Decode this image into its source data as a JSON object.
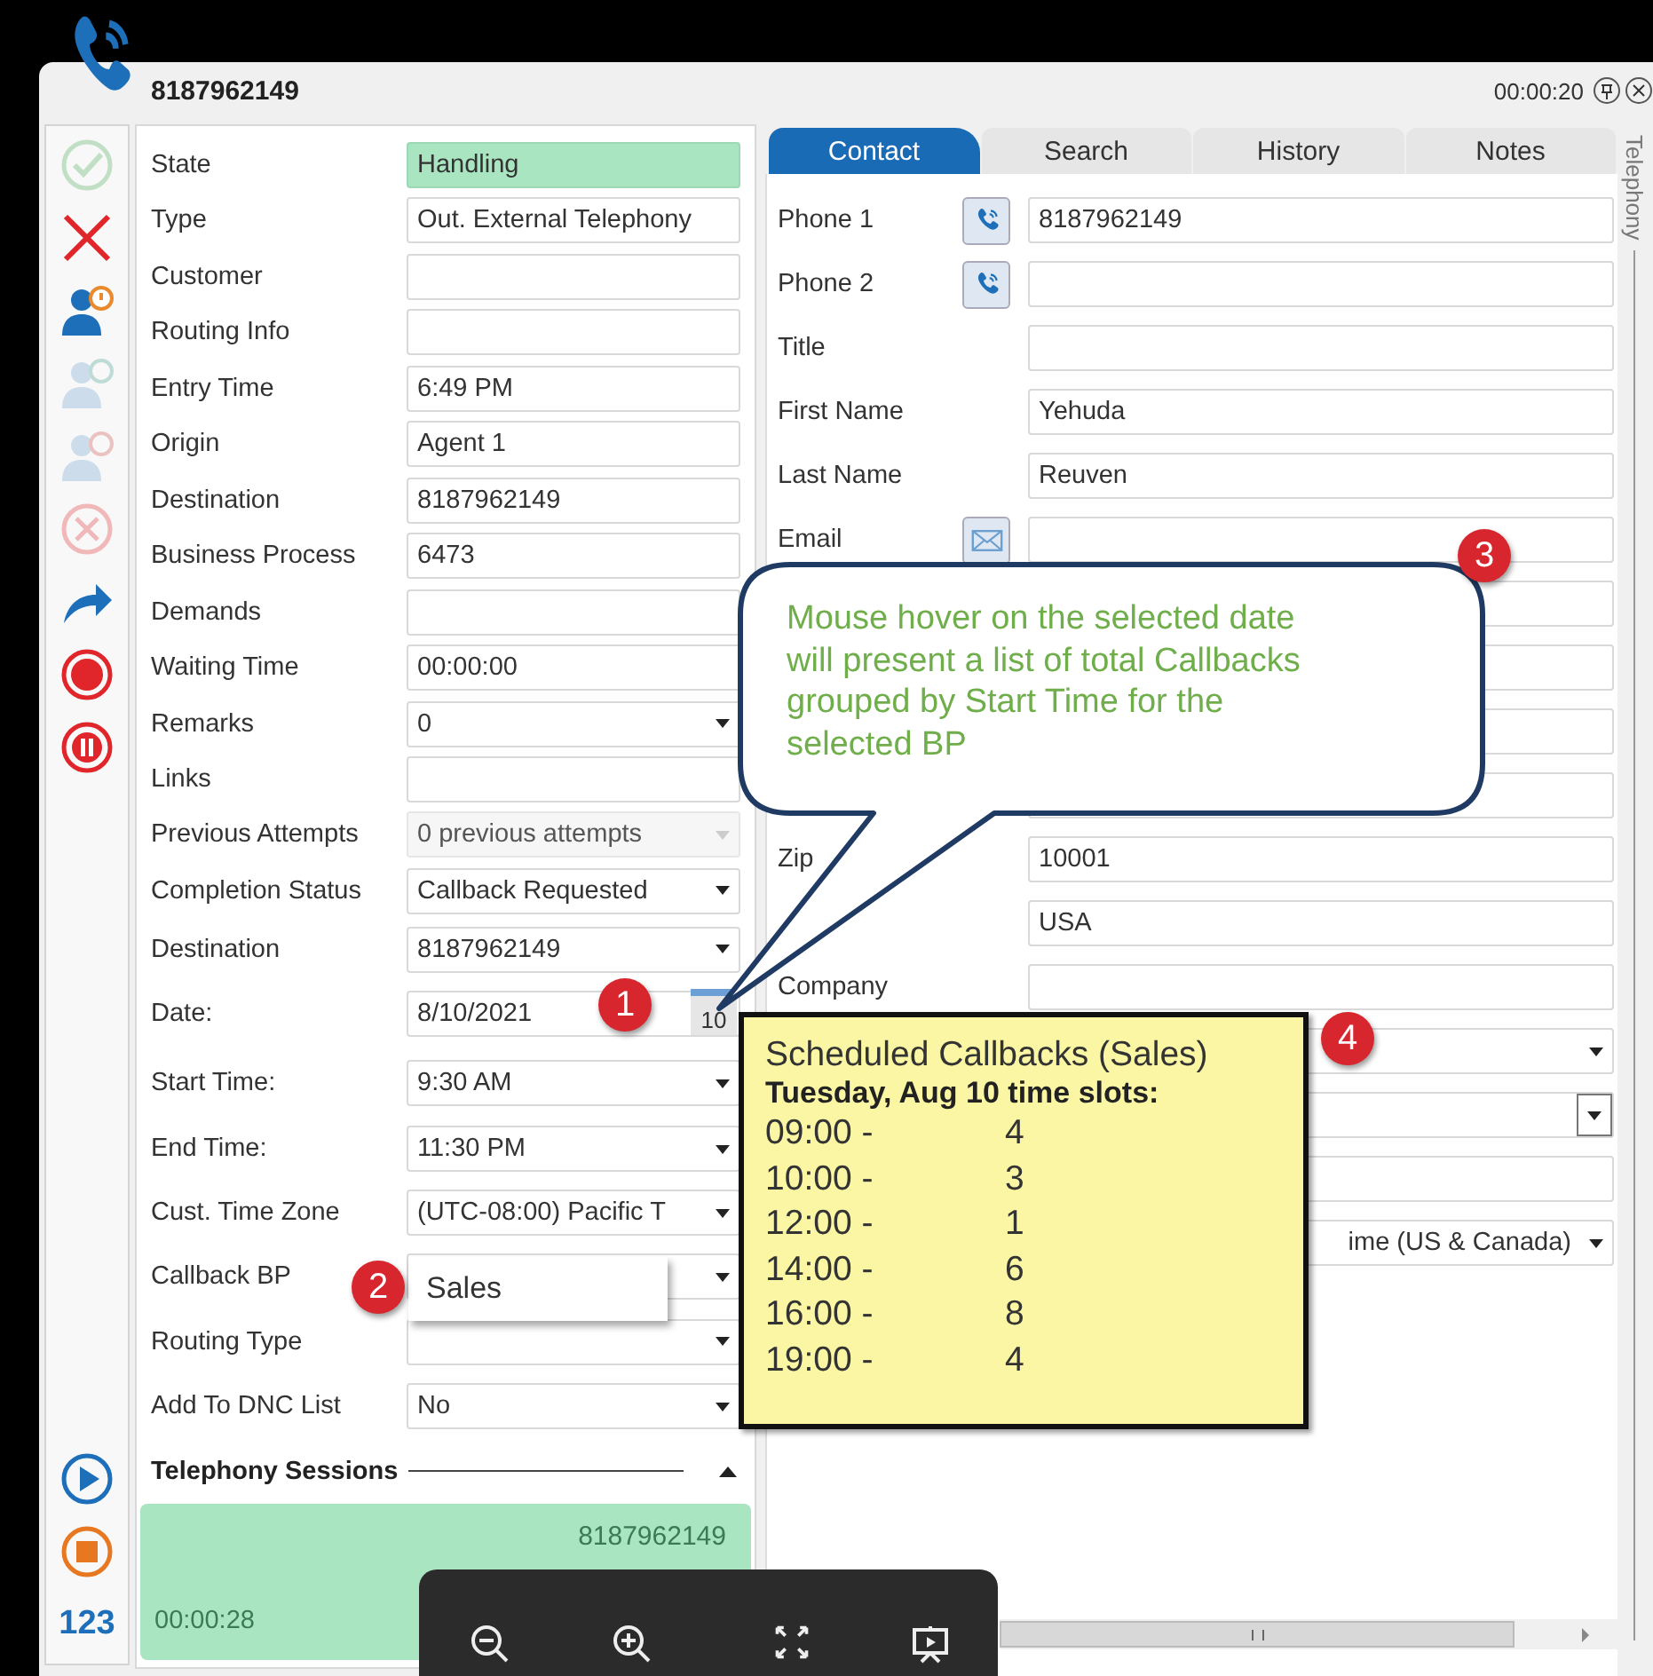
{
  "window": {
    "title": "8187962149",
    "timer": "00:00:20"
  },
  "tools": [
    {
      "kind": "check",
      "disabled": true
    },
    {
      "kind": "cross",
      "disabled": false
    },
    {
      "kind": "person-alert",
      "disabled": false
    },
    {
      "kind": "person-chat",
      "disabled": true
    },
    {
      "kind": "person-help",
      "disabled": true
    },
    {
      "kind": "circle-x",
      "disabled": true
    },
    {
      "kind": "forward",
      "disabled": false
    },
    {
      "kind": "record",
      "disabled": false
    },
    {
      "kind": "pause",
      "disabled": false
    }
  ],
  "bottom_tools": [
    {
      "kind": "play"
    },
    {
      "kind": "stop"
    },
    {
      "kind": "keypad",
      "label": "123"
    }
  ],
  "details": [
    {
      "label": "State",
      "value": "Handling",
      "kind": "status",
      "disabled": false
    },
    {
      "label": "Type",
      "value": "Out. External Telephony",
      "kind": "text",
      "disabled": false
    },
    {
      "label": "Customer",
      "kind": "text",
      "disabled": false
    },
    {
      "label": "Routing Info",
      "kind": "text",
      "disabled": false
    },
    {
      "label": "Entry Time",
      "value": "6:49 PM",
      "kind": "text",
      "disabled": false
    },
    {
      "label": "Origin",
      "value": "Agent 1",
      "kind": "text",
      "disabled": false
    },
    {
      "label": "Destination",
      "value": "8187962149",
      "kind": "text",
      "disabled": false
    },
    {
      "label": "Business Process",
      "value": "6473",
      "kind": "text",
      "disabled": false
    },
    {
      "label": "Demands",
      "kind": "text",
      "disabled": false
    },
    {
      "label": "Waiting Time",
      "value": "00:00:00",
      "kind": "text",
      "disabled": false
    },
    {
      "label": "Remarks",
      "value": "0",
      "kind": "dropdown",
      "disabled": false
    },
    {
      "label": "Links",
      "kind": "text",
      "disabled": false
    },
    {
      "label": "Previous Attempts",
      "value": "0 previous attempts",
      "kind": "dropdown",
      "disabled": true
    },
    {
      "label": "Completion Status",
      "value": "Callback Requested",
      "kind": "dropdown",
      "disabled": false
    },
    {
      "label": "Destination",
      "value": "8187962149",
      "kind": "dropdown",
      "disabled": false
    },
    {
      "label": "Date:",
      "value": "8/10/2021",
      "kind": "date",
      "calendar": "10",
      "disabled": false
    },
    {
      "label": "Start Time:",
      "value": "9:30 AM",
      "kind": "dropdown",
      "disabled": false
    },
    {
      "label": "End Time:",
      "value": "11:30 PM",
      "kind": "dropdown",
      "disabled": false
    },
    {
      "label": "Cust. Time Zone",
      "value": "(UTC-08:00) Pacific T",
      "kind": "dropdown",
      "disabled": false
    },
    {
      "label": "Callback BP",
      "kind": "dropdown",
      "disabled": false
    },
    {
      "label": "Routing Type",
      "kind": "dropdown",
      "disabled": false
    },
    {
      "label": "Add To DNC List",
      "value": "No",
      "kind": "dropdown",
      "disabled": false
    }
  ],
  "callback_bp_popup": {
    "option": "Sales"
  },
  "sessions": {
    "title": "Telephony Sessions",
    "expanded": true,
    "items": [
      {
        "number": "8187962149",
        "duration": "00:00:28"
      }
    ]
  },
  "tabs": [
    {
      "label": "Contact",
      "selected": true
    },
    {
      "label": "Search",
      "selected": false
    },
    {
      "label": "History",
      "selected": false
    },
    {
      "label": "Notes",
      "selected": false
    }
  ],
  "contact": [
    {
      "label": "Phone 1",
      "kind": "phone",
      "value": "8187962149"
    },
    {
      "label": "Phone 2",
      "kind": "phone"
    },
    {
      "label": "Title",
      "kind": "text"
    },
    {
      "label": "First Name",
      "kind": "text",
      "value": "Yehuda"
    },
    {
      "label": "Last Name",
      "kind": "text",
      "value": "Reuven"
    },
    {
      "label": "Email",
      "kind": "email"
    },
    {
      "kind": "text"
    },
    {
      "kind": "text"
    },
    {
      "kind": "text"
    },
    {
      "kind": "text"
    },
    {
      "label": "Zip",
      "kind": "text",
      "value": "10001"
    },
    {
      "kind": "text",
      "value": "USA"
    },
    {
      "label": "Company",
      "kind": "text"
    },
    {
      "kind": "dropdown"
    },
    {
      "kind": "dropdown-boxed"
    },
    {
      "kind": "text"
    },
    {
      "kind": "dropdown",
      "value": "ime (US & Canada)"
    }
  ],
  "side_tab": "Telephony",
  "callout": {
    "badge": "3",
    "lines": [
      "Mouse hover on the selected date",
      "will present a list of total Callbacks",
      "grouped by Start Time for the",
      "selected BP"
    ]
  },
  "markers": [
    {
      "label": "1"
    },
    {
      "label": "2"
    },
    {
      "label": "4"
    }
  ],
  "tooltip": {
    "title": "Scheduled Callbacks (Sales)",
    "subtitle": "Tuesday, Aug 10 time slots:",
    "slots": [
      {
        "time": "09:00 -",
        "count": "4"
      },
      {
        "time": "10:00 -",
        "count": "3"
      },
      {
        "time": "12:00 -",
        "count": "1"
      },
      {
        "time": "14:00 -",
        "count": "6"
      },
      {
        "time": "16:00 -",
        "count": "8"
      },
      {
        "time": "19:00 -",
        "count": "4"
      }
    ]
  }
}
